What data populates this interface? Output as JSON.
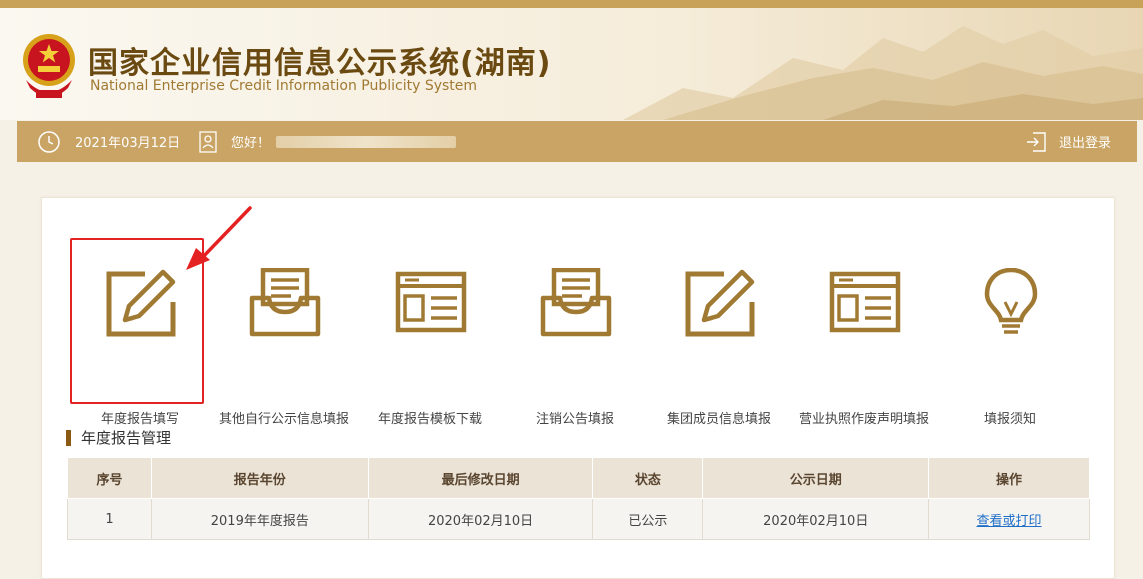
{
  "header": {
    "title": "国家企业信用信息公示系统(湖南)",
    "subtitle": "National Enterprise Credit Information Publicity System"
  },
  "userbar": {
    "date": "2021年03月12日",
    "greeting": "您好！",
    "logout_label": "退出登录"
  },
  "tiles": [
    {
      "label": "年度报告填写",
      "icon": "pencil-edit-icon"
    },
    {
      "label": "其他自行公示信息填报",
      "icon": "inbox-tray-icon"
    },
    {
      "label": "年度报告模板下载",
      "icon": "form-template-icon"
    },
    {
      "label": "注销公告填报",
      "icon": "inbox-tray-icon"
    },
    {
      "label": "集团成员信息填报",
      "icon": "pencil-edit-icon"
    },
    {
      "label": "营业执照作废声明填报",
      "icon": "form-template-icon"
    },
    {
      "label": "填报须知",
      "icon": "lightbulb-icon"
    }
  ],
  "report_section": {
    "title": "年度报告管理",
    "columns": [
      "序号",
      "报告年份",
      "最后修改日期",
      "状态",
      "公示日期",
      "操作"
    ],
    "rows": [
      [
        "1",
        "2019年年度报告",
        "2020年02月10日",
        "已公示",
        "2020年02月10日",
        "查看或打印"
      ]
    ]
  },
  "colors": {
    "gold": "#c9a464",
    "brown": "#8a5a14",
    "highlight_red": "#e52222",
    "link_blue": "#1f6fc8"
  }
}
